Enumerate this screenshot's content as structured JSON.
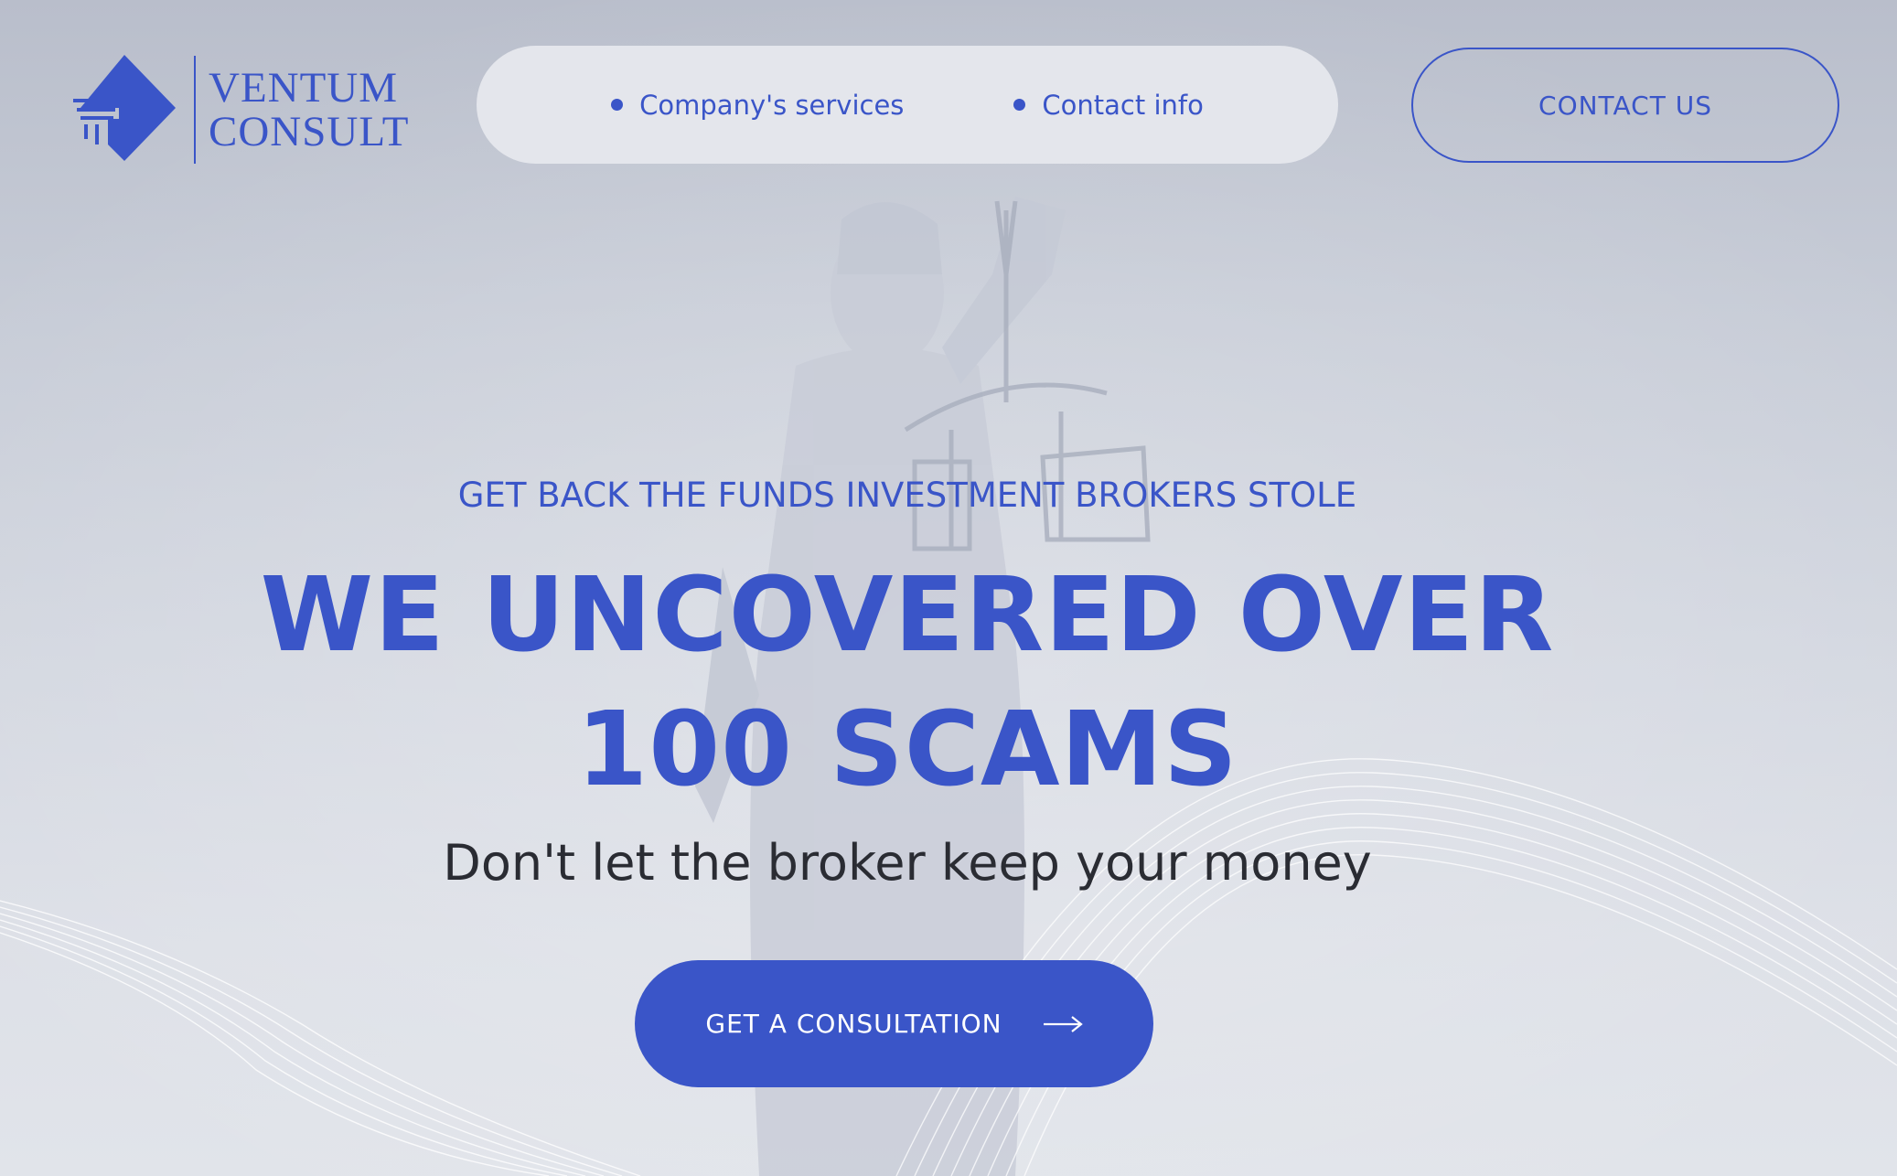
{
  "brand": {
    "line1": "VENTUM",
    "line2": "CONSULT",
    "color": "#3a55c8"
  },
  "nav": {
    "items": [
      {
        "label": "Company's services"
      },
      {
        "label": "Contact info"
      }
    ],
    "contact_button": "CONTACT US"
  },
  "hero": {
    "eyebrow": "GET BACK THE FUNDS INVESTMENT BROKERS STOLE",
    "headline_line1": "WE UNCOVERED OVER",
    "headline_line2": "100 SCAMS",
    "subheadline": "Don't let the broker keep your money",
    "cta_label": "GET A CONSULTATION",
    "cta_icon": "arrow-right-icon"
  },
  "colors": {
    "accent": "#3a55c8",
    "nav_background": "#e4e6ec",
    "text_dark": "#2a2c33"
  }
}
